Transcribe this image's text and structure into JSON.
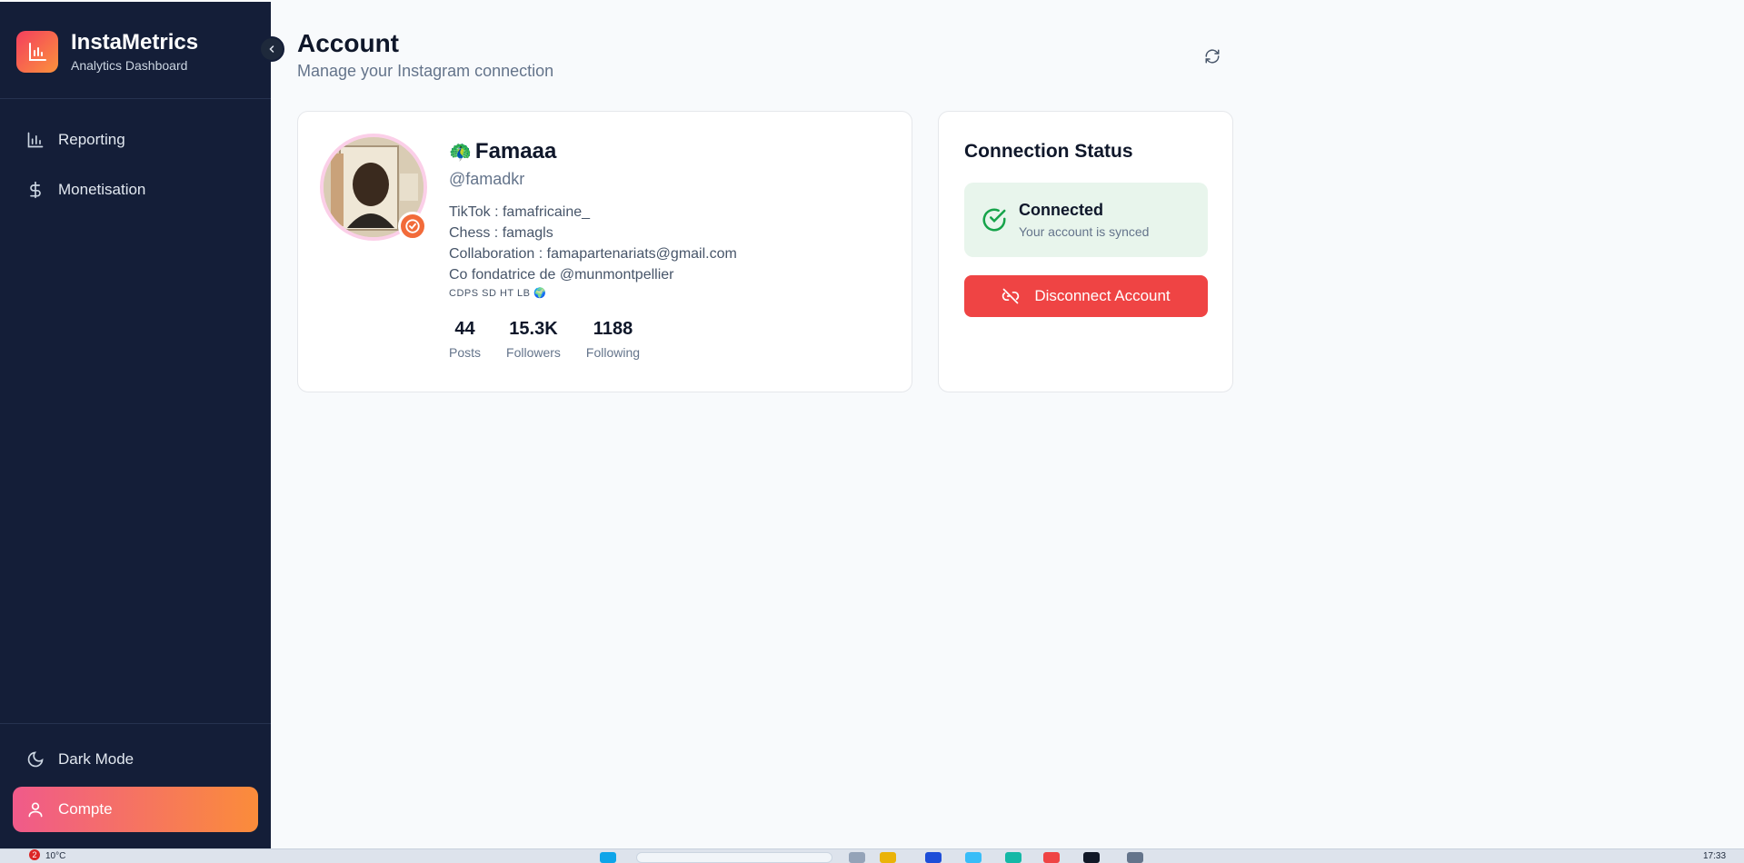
{
  "brand": {
    "title": "InstaMetrics",
    "subtitle": "Analytics Dashboard",
    "logo_icon": "bar-chart-icon"
  },
  "sidebar": {
    "items": [
      {
        "label": "Reporting",
        "icon": "bar-chart-icon"
      },
      {
        "label": "Monetisation",
        "icon": "dollar-icon"
      }
    ],
    "bottom": [
      {
        "label": "Dark Mode",
        "icon": "moon-icon"
      },
      {
        "label": "Compte",
        "icon": "user-icon",
        "active": true
      }
    ]
  },
  "header": {
    "title": "Account",
    "subtitle": "Manage your Instagram connection"
  },
  "profile": {
    "name_emoji": "🦚",
    "name": "Famaaa",
    "handle": "@famadkr",
    "bio": [
      "TikTok : famafricaine_",
      "Chess : famagls",
      "Collaboration : famapartenariats@gmail.com",
      "Co fondatrice de @munmontpellier"
    ],
    "bio_tags": "CDPS SD HT LB 🌍",
    "stats": [
      {
        "value": "44",
        "label": "Posts"
      },
      {
        "value": "15.3K",
        "label": "Followers"
      },
      {
        "value": "1188",
        "label": "Following"
      }
    ]
  },
  "connection": {
    "title": "Connection Status",
    "status": "Connected",
    "description": "Your account is synced",
    "disconnect_label": "Disconnect Account"
  },
  "taskbar": {
    "weather": "10°C",
    "notification_count": "2",
    "clock": "17:33"
  },
  "colors": {
    "sidebar_bg": "#141e38",
    "accent_gradient_start": "#f05a8a",
    "accent_gradient_end": "#fb8c3a",
    "danger": "#ef4444",
    "success": "#16a34a"
  }
}
